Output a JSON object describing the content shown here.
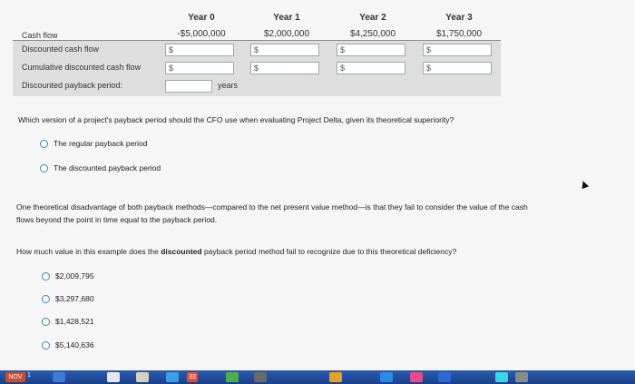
{
  "table": {
    "headers": [
      "Year 0",
      "Year 1",
      "Year 2",
      "Year 3"
    ],
    "cash_flow_label": "Cash flow",
    "cash_flows": [
      "-$5,000,000",
      "$2,000,000",
      "$4,250,000",
      "$1,750,000"
    ],
    "discounted_label": "Discounted cash flow",
    "cumulative_label": "Cumulative discounted cash flow",
    "payback_label": "Discounted payback period:",
    "dollar_sign": "$",
    "years_label": "years"
  },
  "q1": {
    "text": "Which version of a project's payback period should the CFO use when evaluating Project Delta, given its theoretical superiority?",
    "options": [
      "The regular payback period",
      "The discounted payback period"
    ]
  },
  "q2": {
    "paragraph_line1": "One theoretical disadvantage of both payback methods—compared to the net present value method—is that they fail to consider the value of the cash",
    "paragraph_line2": "flows beyond the point in time equal to the payback period."
  },
  "q3": {
    "text_before": "How much value in this example does the ",
    "text_bold": "discounted",
    "text_after": " payback period method fail to recognize due to this theoretical deficiency?",
    "options": [
      "$2,009,795",
      "$3,297,680",
      "$1,428,521",
      "$5,140,636"
    ]
  },
  "taskbar": {
    "badge": "33",
    "start_label": "NOV",
    "counter": "1"
  }
}
